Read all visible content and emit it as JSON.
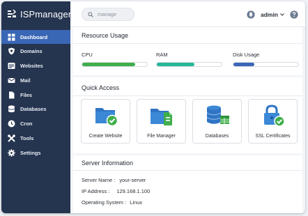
{
  "app": {
    "name": "ISPmanager"
  },
  "sidebar": {
    "items": [
      {
        "label": "Dashboard",
        "icon": "dashboard-icon",
        "active": true
      },
      {
        "label": "Domains",
        "icon": "shield-icon"
      },
      {
        "label": "Websites",
        "icon": "websites-icon"
      },
      {
        "label": "Mail",
        "icon": "mail-icon"
      },
      {
        "label": "Files",
        "icon": "files-icon"
      },
      {
        "label": "Databases",
        "icon": "database-icon"
      },
      {
        "label": "Cron",
        "icon": "clock-icon"
      },
      {
        "label": "Tools",
        "icon": "tools-icon"
      },
      {
        "label": "Settings",
        "icon": "gear-icon"
      }
    ]
  },
  "header": {
    "search": {
      "placeholder": "manage"
    },
    "user": {
      "name": "admin"
    }
  },
  "resource_usage": {
    "title": "Resource Usage",
    "items": [
      {
        "label": "CPU",
        "percent": 82,
        "color": "#3fae4b"
      },
      {
        "label": "RAM",
        "percent": 58,
        "color": "#26b79a"
      },
      {
        "label": "Disk Usage",
        "percent": 32,
        "color": "#3a66b6"
      }
    ]
  },
  "quick_access": {
    "title": "Quick Access",
    "cards": [
      {
        "label": "Create Website",
        "icon": "folder-check-icon"
      },
      {
        "label": "File Manager",
        "icon": "folder-file-icon"
      },
      {
        "label": "Databases",
        "icon": "database-table-icon"
      },
      {
        "label": "SSL Certificates",
        "icon": "lock-check-icon"
      }
    ]
  },
  "server_info": {
    "title": "Server Information",
    "rows": [
      {
        "key": "Server Name :",
        "value": "your-server"
      },
      {
        "key": "IP Address :",
        "value": "129.168.1.100"
      },
      {
        "key": "Operating System :",
        "value": "Linux"
      }
    ]
  },
  "colors": {
    "sidebar": "#25344f",
    "active": "#3a66b6",
    "accent_green": "#3fae4b"
  }
}
